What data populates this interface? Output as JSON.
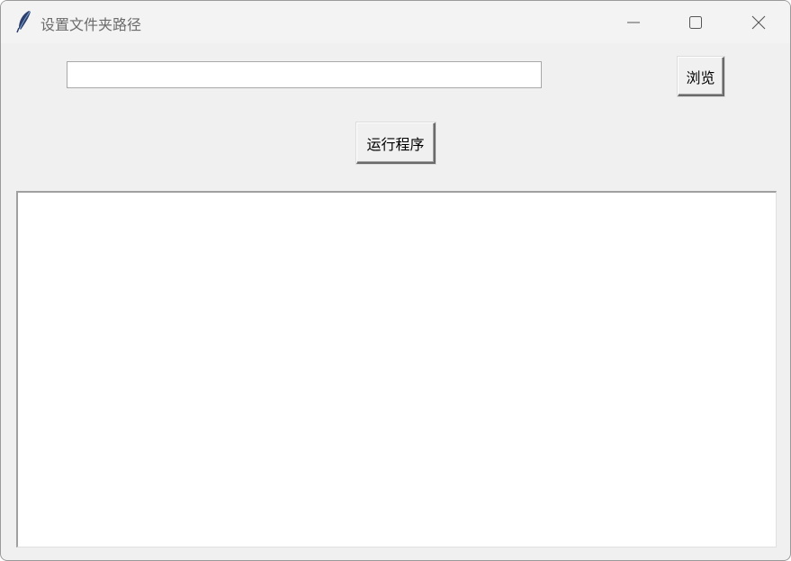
{
  "window": {
    "title": "设置文件夹路径",
    "icon": "feather-icon",
    "controls": {
      "minimize": "minimize-icon",
      "maximize": "maximize-icon",
      "close": "close-icon"
    }
  },
  "path_field": {
    "value": ""
  },
  "buttons": {
    "browse_label": "浏览",
    "run_label": "运行程序"
  },
  "output": {
    "text": ""
  }
}
